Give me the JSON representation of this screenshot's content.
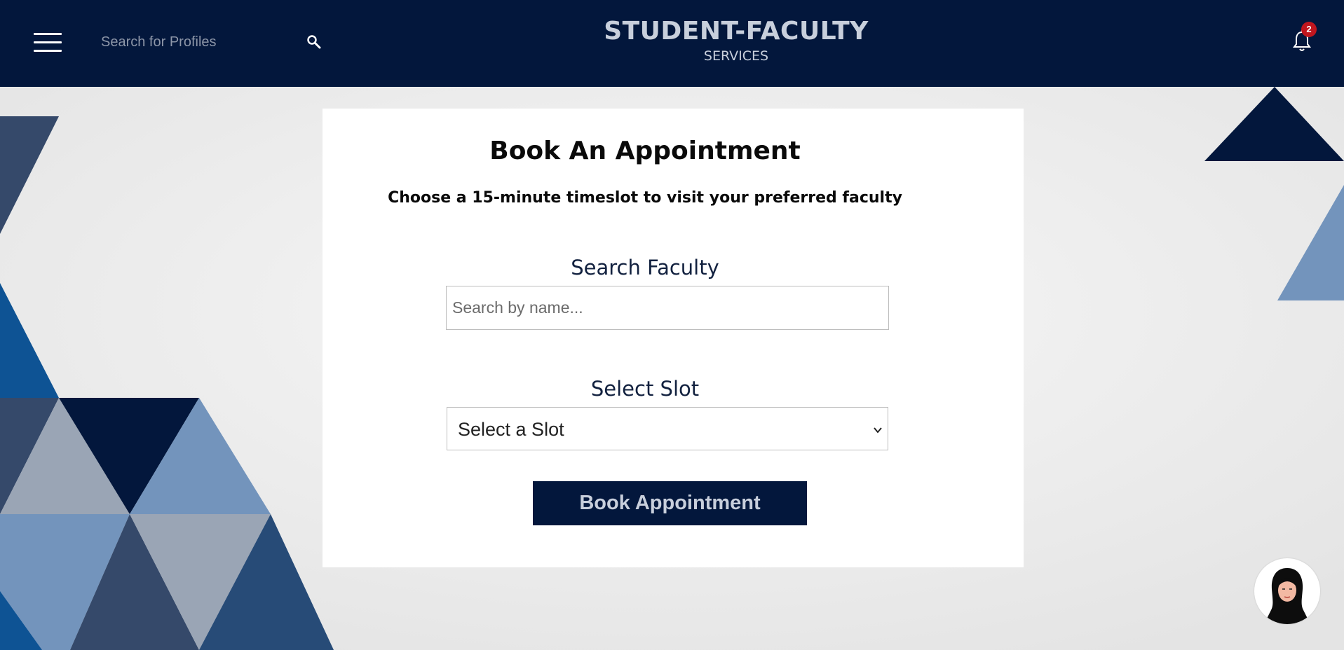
{
  "header": {
    "search_placeholder": "Search for Profiles",
    "brand_title": "STUDENT-FACULTY",
    "brand_subtitle": "SERVICES",
    "notification_count": "2"
  },
  "card": {
    "title": "Book An Appointment",
    "subtitle": "Choose a 15-minute timeslot to visit your preferred faculty",
    "search_label": "Search Faculty",
    "search_placeholder": "Search by name...",
    "slot_label": "Select Slot",
    "slot_selected": "Select a Slot",
    "book_button": "Book Appointment"
  },
  "icons": {
    "menu": "hamburger-icon",
    "search": "search-icon",
    "notifications": "bell-icon",
    "slot_dropdown": "chevron-down-icon",
    "assistant": "avatar-icon"
  },
  "colors": {
    "header_bg": "#03173c",
    "button_bg": "#03173c",
    "badge": "#c0161e"
  }
}
